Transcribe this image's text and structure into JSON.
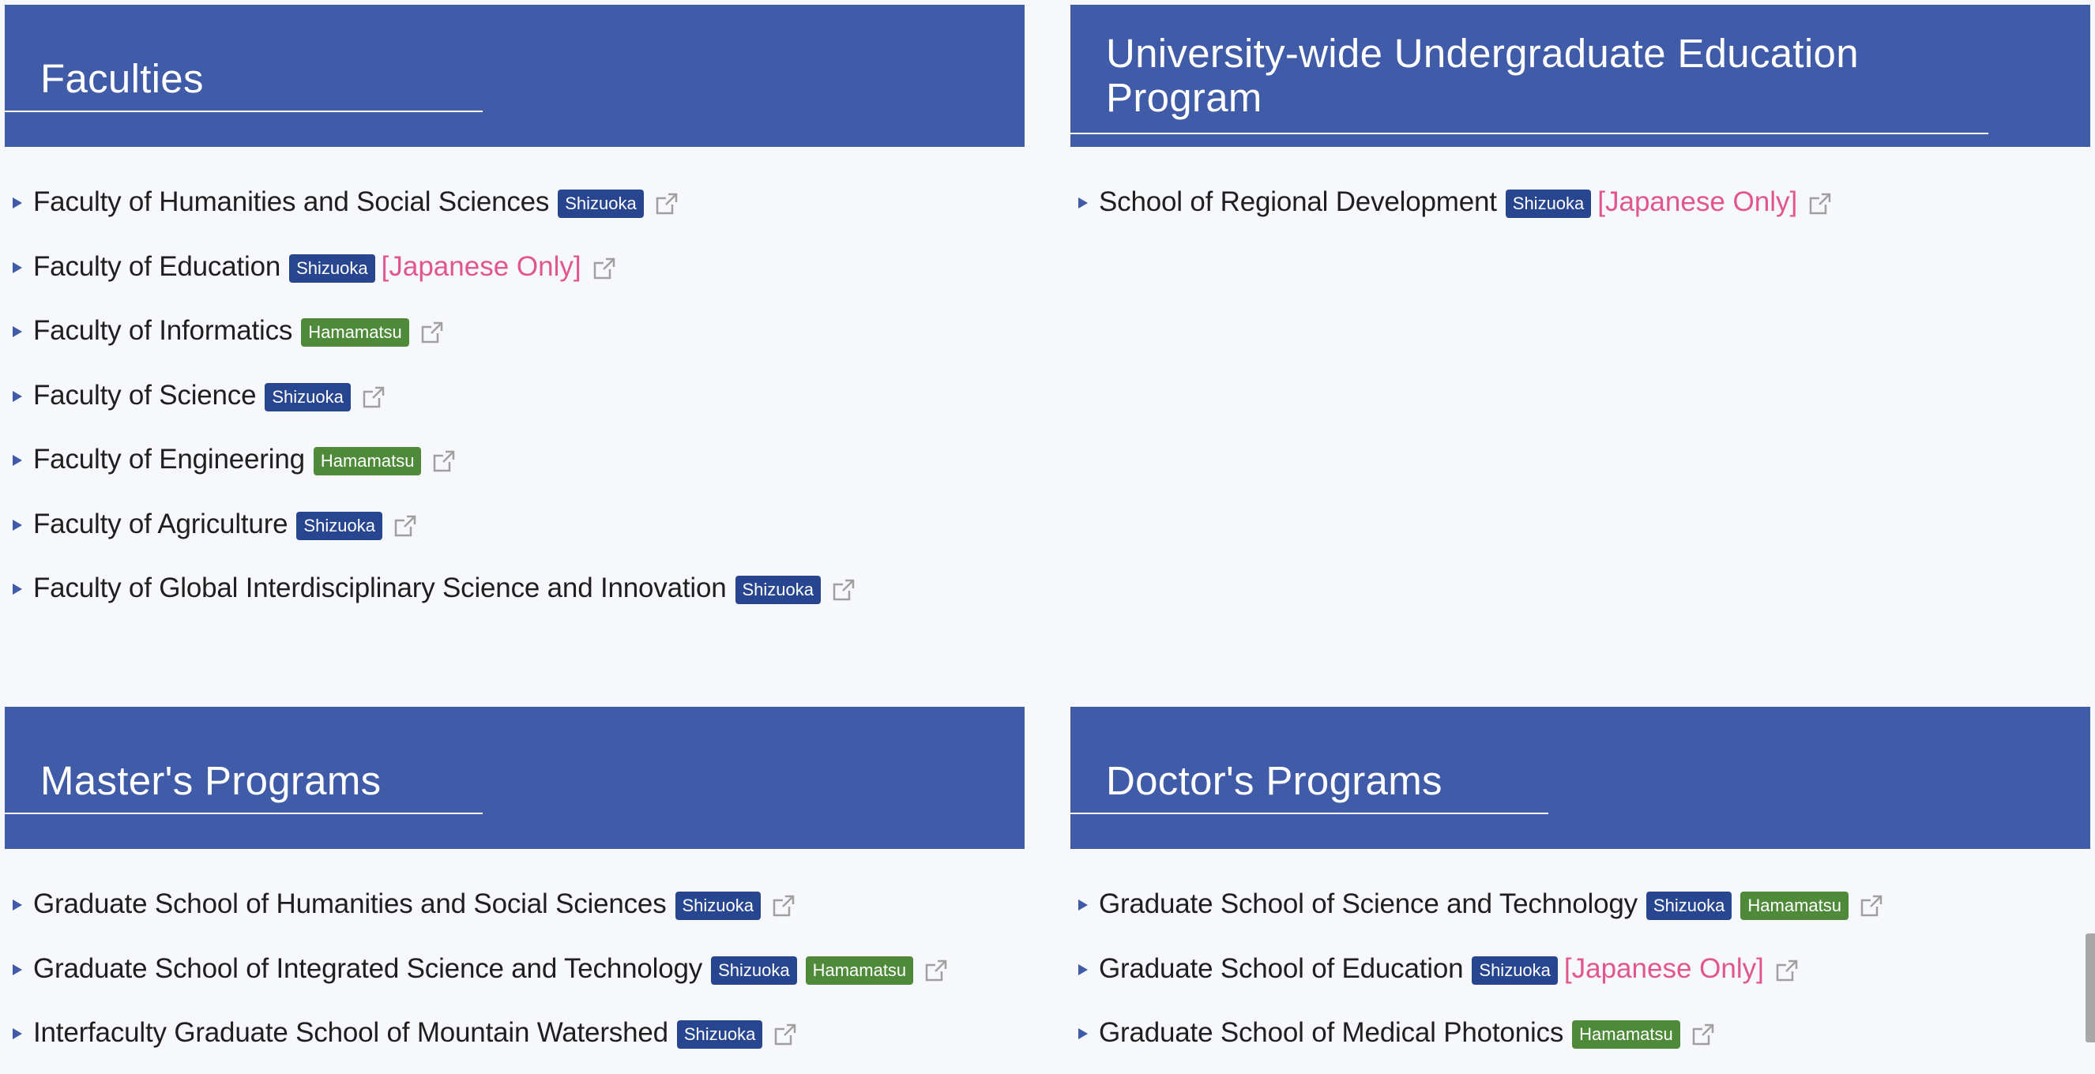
{
  "sections": {
    "faculties": {
      "title": "Faculties",
      "items": [
        {
          "name": "Faculty of Humanities and Social Sciences",
          "badges": [
            "Shizuoka"
          ],
          "note": ""
        },
        {
          "name": "Faculty of Education",
          "badges": [
            "Shizuoka"
          ],
          "note": "[Japanese Only]"
        },
        {
          "name": "Faculty of Informatics",
          "badges": [
            "Hamamatsu"
          ],
          "note": ""
        },
        {
          "name": "Faculty of Science",
          "badges": [
            "Shizuoka"
          ],
          "note": ""
        },
        {
          "name": "Faculty of Engineering",
          "badges": [
            "Hamamatsu"
          ],
          "note": ""
        },
        {
          "name": "Faculty of Agriculture",
          "badges": [
            "Shizuoka"
          ],
          "note": ""
        },
        {
          "name": "Faculty of Global Interdisciplinary Science and Innovation",
          "badges": [
            "Shizuoka"
          ],
          "note": ""
        }
      ]
    },
    "undergrad_program": {
      "title": "University-wide Undergraduate Education Program",
      "items": [
        {
          "name": "School of Regional Development",
          "badges": [
            "Shizuoka"
          ],
          "note": "[Japanese Only]"
        }
      ]
    },
    "masters": {
      "title": "Master's Programs",
      "items": [
        {
          "name": "Graduate School of Humanities and Social Sciences",
          "badges": [
            "Shizuoka"
          ],
          "note": ""
        },
        {
          "name": "Graduate School of Integrated Science and Technology",
          "badges": [
            "Shizuoka",
            "Hamamatsu"
          ],
          "note": ""
        },
        {
          "name": "Interfaculty Graduate School of Mountain Watershed",
          "badges": [
            "Shizuoka"
          ],
          "note": ""
        }
      ]
    },
    "doctors": {
      "title": "Doctor's Programs",
      "items": [
        {
          "name": "Graduate School of Science and Technology",
          "badges": [
            "Shizuoka",
            "Hamamatsu"
          ],
          "note": ""
        },
        {
          "name": "Graduate School of Education",
          "badges": [
            "Shizuoka"
          ],
          "note": "[Japanese Only]"
        },
        {
          "name": "Graduate School of Medical Photonics",
          "badges": [
            "Hamamatsu"
          ],
          "note": ""
        }
      ]
    }
  },
  "colors": {
    "header_bg": "#405ba7",
    "shizuoka_badge": "#28468f",
    "hamamatsu_badge": "#4f8a3b",
    "japanese_only": "#e0578f",
    "page_bg": "#f7f8fb"
  },
  "icons": {
    "bullet": "triangle-right-icon",
    "external": "external-link-icon"
  }
}
